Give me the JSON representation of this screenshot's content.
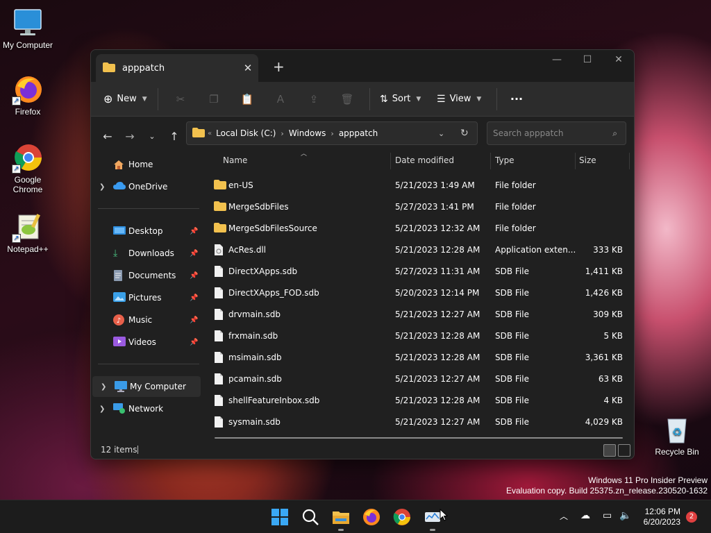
{
  "desktop": {
    "icons": [
      {
        "label": "My Computer",
        "icon": "monitor-icon"
      },
      {
        "label": "Firefox",
        "icon": "firefox-icon"
      },
      {
        "label": "Google Chrome",
        "icon": "chrome-icon"
      },
      {
        "label": "Notepad++",
        "icon": "notepadpp-icon"
      },
      {
        "label": "Recycle Bin",
        "icon": "recycle-bin-icon"
      }
    ],
    "watermark_line1": "Windows 11 Pro Insider Preview",
    "watermark_line2": "Evaluation copy. Build 25375.zn_release.230520-1632"
  },
  "window": {
    "tab_title": "apppatch",
    "toolbar": {
      "new_label": "New",
      "sort_label": "Sort",
      "view_label": "View"
    },
    "breadcrumbs": [
      "Local Disk (C:)",
      "Windows",
      "apppatch"
    ],
    "search_placeholder": "Search apppatch",
    "sidebar": {
      "home": "Home",
      "onedrive": "OneDrive",
      "quick": [
        {
          "label": "Desktop",
          "icon": "desktop-folder-icon"
        },
        {
          "label": "Downloads",
          "icon": "download-icon"
        },
        {
          "label": "Documents",
          "icon": "documents-icon"
        },
        {
          "label": "Pictures",
          "icon": "pictures-icon"
        },
        {
          "label": "Music",
          "icon": "music-icon"
        },
        {
          "label": "Videos",
          "icon": "videos-icon"
        }
      ],
      "my_computer": "My Computer",
      "network": "Network"
    },
    "columns": {
      "name": "Name",
      "date": "Date modified",
      "type": "Type",
      "size": "Size"
    },
    "files": [
      {
        "name": "en-US",
        "date": "5/21/2023 1:49 AM",
        "type": "File folder",
        "size": "",
        "kind": "folder"
      },
      {
        "name": "MergeSdbFiles",
        "date": "5/27/2023 1:41 PM",
        "type": "File folder",
        "size": "",
        "kind": "folder"
      },
      {
        "name": "MergeSdbFilesSource",
        "date": "5/21/2023 12:32 AM",
        "type": "File folder",
        "size": "",
        "kind": "folder"
      },
      {
        "name": "AcRes.dll",
        "date": "5/21/2023 12:28 AM",
        "type": "Application exten...",
        "size": "333 KB",
        "kind": "dll"
      },
      {
        "name": "DirectXApps.sdb",
        "date": "5/27/2023 11:31 AM",
        "type": "SDB File",
        "size": "1,411 KB",
        "kind": "file"
      },
      {
        "name": "DirectXApps_FOD.sdb",
        "date": "5/20/2023 12:14 PM",
        "type": "SDB File",
        "size": "1,426 KB",
        "kind": "file"
      },
      {
        "name": "drvmain.sdb",
        "date": "5/21/2023 12:27 AM",
        "type": "SDB File",
        "size": "309 KB",
        "kind": "file"
      },
      {
        "name": "frxmain.sdb",
        "date": "5/21/2023 12:28 AM",
        "type": "SDB File",
        "size": "5 KB",
        "kind": "file"
      },
      {
        "name": "msimain.sdb",
        "date": "5/21/2023 12:28 AM",
        "type": "SDB File",
        "size": "3,361 KB",
        "kind": "file"
      },
      {
        "name": "pcamain.sdb",
        "date": "5/21/2023 12:27 AM",
        "type": "SDB File",
        "size": "63 KB",
        "kind": "file"
      },
      {
        "name": "shellFeatureInbox.sdb",
        "date": "5/21/2023 12:28 AM",
        "type": "SDB File",
        "size": "4 KB",
        "kind": "file"
      },
      {
        "name": "sysmain.sdb",
        "date": "5/21/2023 12:27 AM",
        "type": "SDB File",
        "size": "4,029 KB",
        "kind": "file"
      }
    ],
    "status_count": "12 items"
  },
  "taskbar": {
    "time": "12:06 PM",
    "date": "6/20/2023",
    "notification_count": "2"
  },
  "colors": {
    "folder": "#f2c14e",
    "accent": "#4aa3f0"
  }
}
